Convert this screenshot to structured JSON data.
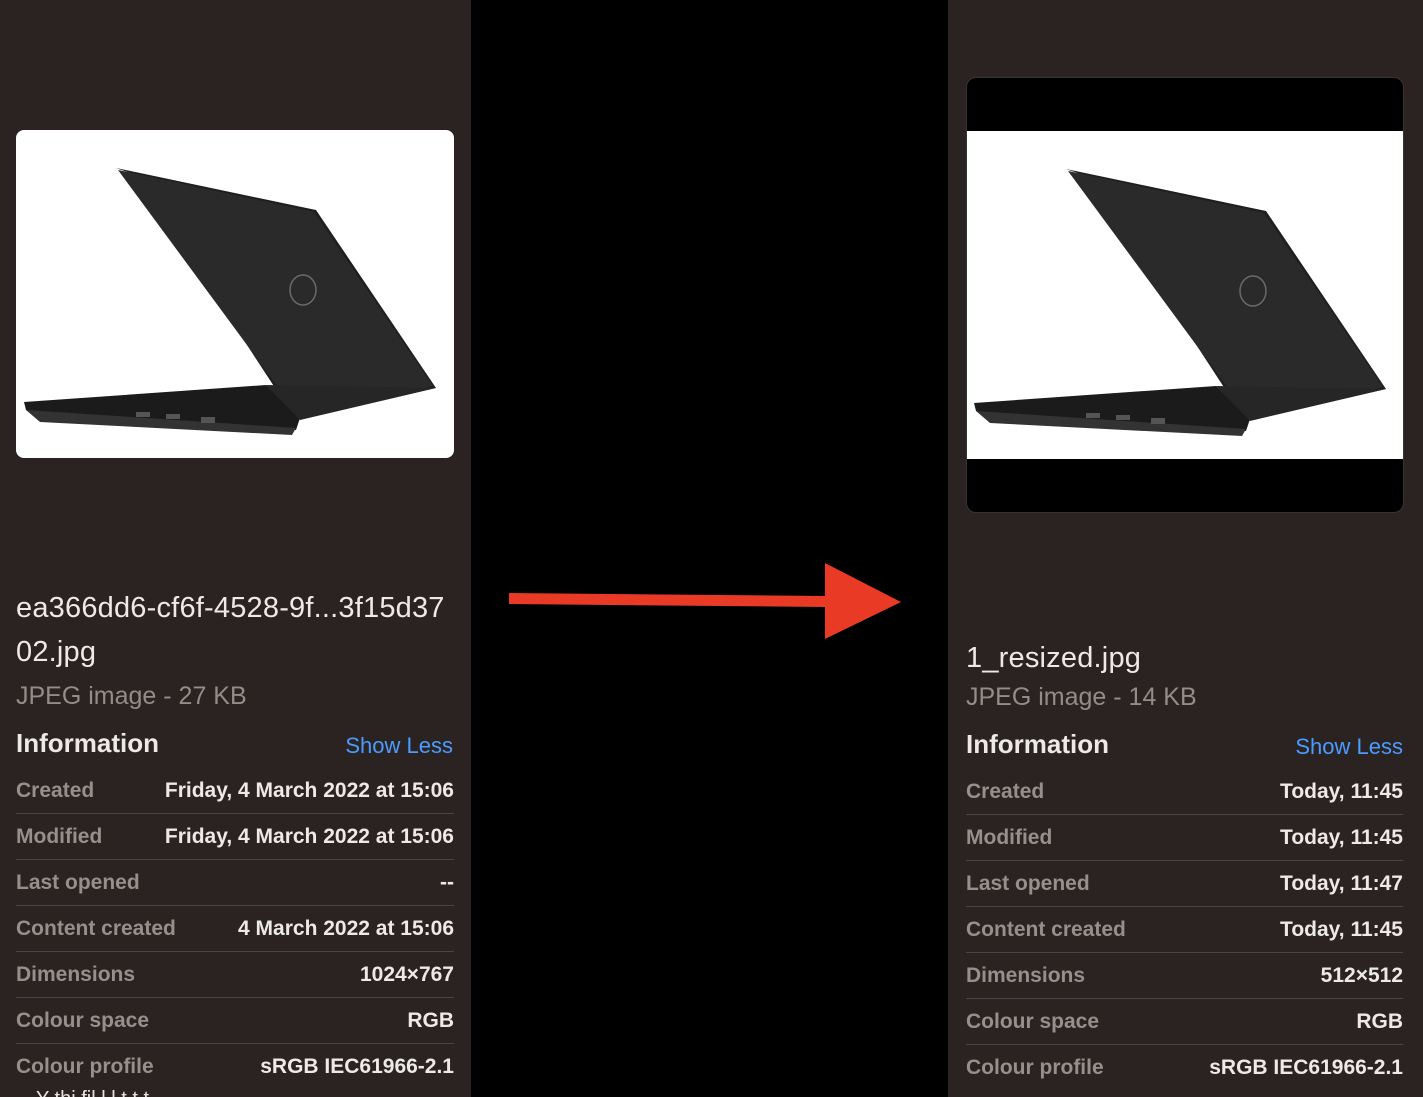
{
  "left": {
    "filename": "ea366dd6-cf6f-4528-9f...3f15d3702.jpg",
    "kind": "JPEG image - 27 KB",
    "info_title": "Information",
    "show_less": "Show Less",
    "rows": [
      {
        "label": "Created",
        "value": "Friday, 4 March 2022 at 15:06"
      },
      {
        "label": "Modified",
        "value": "Friday, 4 March 2022 at 15:06"
      },
      {
        "label": "Last opened",
        "value": "--"
      },
      {
        "label": "Content created",
        "value": "4 March 2022 at 15:06"
      },
      {
        "label": "Dimensions",
        "value": "1024×767"
      },
      {
        "label": "Colour space",
        "value": "RGB"
      },
      {
        "label": "Colour profile",
        "value": "sRGB IEC61966-2.1"
      }
    ],
    "cutoff_text": "Y         thi  fil   l  l  t        t   t"
  },
  "right": {
    "filename": "1_resized.jpg",
    "kind": "JPEG image - 14 KB",
    "info_title": "Information",
    "show_less": "Show Less",
    "rows": [
      {
        "label": "Created",
        "value": "Today, 11:45"
      },
      {
        "label": "Modified",
        "value": "Today, 11:45"
      },
      {
        "label": "Last opened",
        "value": "Today, 11:47"
      },
      {
        "label": "Content created",
        "value": "Today, 11:45"
      },
      {
        "label": "Dimensions",
        "value": "512×512"
      },
      {
        "label": "Colour space",
        "value": "RGB"
      },
      {
        "label": "Colour profile",
        "value": "sRGB IEC61966-2.1"
      }
    ]
  },
  "colors": {
    "panel_bg": "#2b2321",
    "accent_link": "#4a9cff",
    "arrow": "#e83a25"
  },
  "icons": {
    "arrow": "right-arrow-icon",
    "laptop": "laptop-image"
  }
}
